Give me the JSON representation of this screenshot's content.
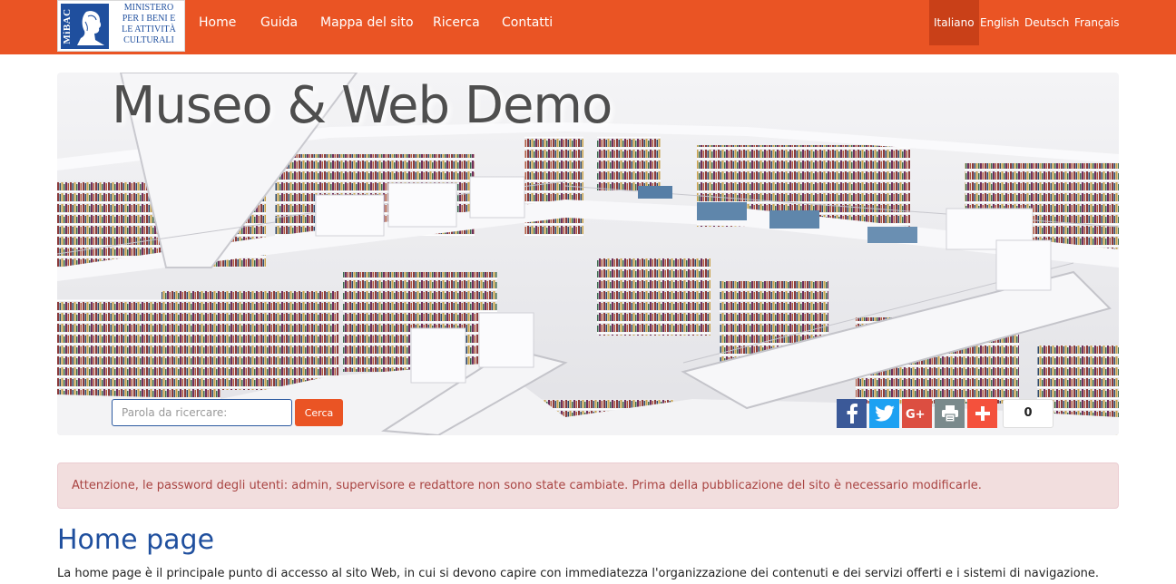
{
  "logo": {
    "mark_text": "MiBAC",
    "lines": [
      "MINISTERO",
      "PER I BENI E",
      "LE ATTIVITÀ",
      "CULTURALI"
    ]
  },
  "nav": {
    "home": "Home",
    "guida": "Guida",
    "mappa": "Mappa del sito",
    "ricerca": "Ricerca",
    "contatti": "Contatti"
  },
  "languages": {
    "active": "Italiano",
    "english": "English",
    "deutsch": "Deutsch",
    "francais": "Français"
  },
  "hero": {
    "title": "Museo & Web Demo",
    "search_placeholder": "Parola da ricercare:",
    "search_button": "Cerca",
    "share_count": "0"
  },
  "share_icons": [
    "facebook-icon",
    "twitter-icon",
    "google-plus-icon",
    "print-icon",
    "plus-icon"
  ],
  "alert": {
    "text": "Attenzione, le password degli utenti: admin, supervisore e redattore non sono state cambiate. Prima della pubblicazione del sito è necessario modificarle."
  },
  "content": {
    "title": "Home page",
    "intro": "La home page è il principale punto di accesso al sito Web, in cui si devono capire con immediatezza l'organizzazione dei contenuti e dei servizi offerti e i sistemi di navigazione."
  },
  "colors": {
    "brand_orange": "#ea5424",
    "active_language_bg": "#c94018",
    "ministry_blue": "#1f4f9e",
    "alert_bg": "#f2dede",
    "alert_text": "#a94442",
    "facebook": "#3b5998",
    "twitter": "#1da1f2",
    "google_plus": "#dc4e41",
    "print": "#7a8a8c",
    "plus": "#f4513c"
  }
}
